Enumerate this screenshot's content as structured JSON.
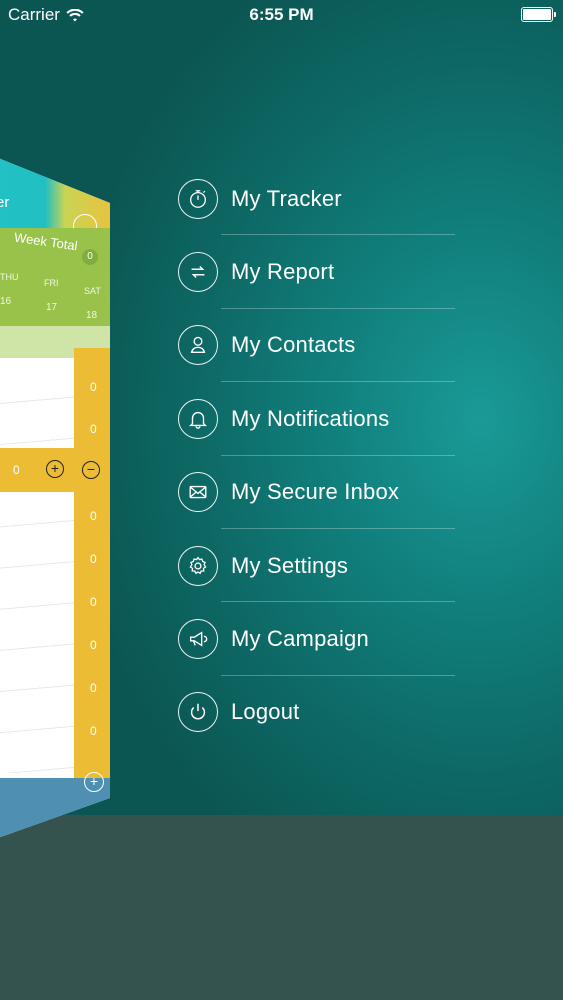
{
  "status_bar": {
    "carrier": "Carrier",
    "time": "6:55 PM",
    "icons": [
      "wifi-icon",
      "battery-icon"
    ]
  },
  "preview": {
    "title_fragment": "er",
    "week_total_label": "Week Total",
    "week_total_value": "0",
    "days": [
      {
        "name": "THU",
        "date": "16"
      },
      {
        "name": "FRI",
        "date": "17"
      },
      {
        "name": "SAT",
        "date": "18"
      }
    ],
    "row_values": [
      "0",
      "0",
      "0",
      "0",
      "0",
      "0",
      "0",
      "0",
      "0"
    ],
    "active_row_value": "0",
    "colors": {
      "cyan": "#21c1c4",
      "green": "#98c24a",
      "yellow": "#edbc35",
      "blue": "#4f8fb2"
    }
  },
  "menu": {
    "items": [
      {
        "label": "My Tracker",
        "icon": "stopwatch-icon"
      },
      {
        "label": "My Report",
        "icon": "report-arrows-icon"
      },
      {
        "label": "My Contacts",
        "icon": "person-icon"
      },
      {
        "label": "My Notifications",
        "icon": "bell-icon"
      },
      {
        "label": "My Secure Inbox",
        "icon": "envelope-icon"
      },
      {
        "label": "My Settings",
        "icon": "gear-icon"
      },
      {
        "label": "My Campaign",
        "icon": "megaphone-icon"
      },
      {
        "label": "Logout",
        "icon": "power-icon"
      }
    ]
  },
  "colors": {
    "background": "#0d6763",
    "background_highlight": "#1a9a97",
    "floor": "#34534f"
  }
}
